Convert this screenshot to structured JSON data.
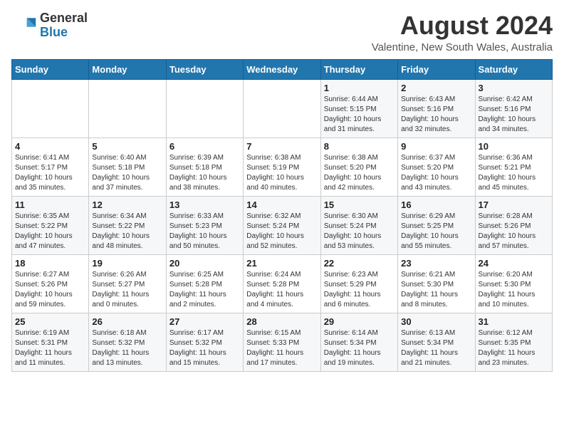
{
  "header": {
    "logo_general": "General",
    "logo_blue": "Blue",
    "month_year": "August 2024",
    "location": "Valentine, New South Wales, Australia"
  },
  "weekdays": [
    "Sunday",
    "Monday",
    "Tuesday",
    "Wednesday",
    "Thursday",
    "Friday",
    "Saturday"
  ],
  "weeks": [
    [
      {
        "day": "",
        "info": ""
      },
      {
        "day": "",
        "info": ""
      },
      {
        "day": "",
        "info": ""
      },
      {
        "day": "",
        "info": ""
      },
      {
        "day": "1",
        "info": "Sunrise: 6:44 AM\nSunset: 5:15 PM\nDaylight: 10 hours\nand 31 minutes."
      },
      {
        "day": "2",
        "info": "Sunrise: 6:43 AM\nSunset: 5:16 PM\nDaylight: 10 hours\nand 32 minutes."
      },
      {
        "day": "3",
        "info": "Sunrise: 6:42 AM\nSunset: 5:16 PM\nDaylight: 10 hours\nand 34 minutes."
      }
    ],
    [
      {
        "day": "4",
        "info": "Sunrise: 6:41 AM\nSunset: 5:17 PM\nDaylight: 10 hours\nand 35 minutes."
      },
      {
        "day": "5",
        "info": "Sunrise: 6:40 AM\nSunset: 5:18 PM\nDaylight: 10 hours\nand 37 minutes."
      },
      {
        "day": "6",
        "info": "Sunrise: 6:39 AM\nSunset: 5:18 PM\nDaylight: 10 hours\nand 38 minutes."
      },
      {
        "day": "7",
        "info": "Sunrise: 6:38 AM\nSunset: 5:19 PM\nDaylight: 10 hours\nand 40 minutes."
      },
      {
        "day": "8",
        "info": "Sunrise: 6:38 AM\nSunset: 5:20 PM\nDaylight: 10 hours\nand 42 minutes."
      },
      {
        "day": "9",
        "info": "Sunrise: 6:37 AM\nSunset: 5:20 PM\nDaylight: 10 hours\nand 43 minutes."
      },
      {
        "day": "10",
        "info": "Sunrise: 6:36 AM\nSunset: 5:21 PM\nDaylight: 10 hours\nand 45 minutes."
      }
    ],
    [
      {
        "day": "11",
        "info": "Sunrise: 6:35 AM\nSunset: 5:22 PM\nDaylight: 10 hours\nand 47 minutes."
      },
      {
        "day": "12",
        "info": "Sunrise: 6:34 AM\nSunset: 5:22 PM\nDaylight: 10 hours\nand 48 minutes."
      },
      {
        "day": "13",
        "info": "Sunrise: 6:33 AM\nSunset: 5:23 PM\nDaylight: 10 hours\nand 50 minutes."
      },
      {
        "day": "14",
        "info": "Sunrise: 6:32 AM\nSunset: 5:24 PM\nDaylight: 10 hours\nand 52 minutes."
      },
      {
        "day": "15",
        "info": "Sunrise: 6:30 AM\nSunset: 5:24 PM\nDaylight: 10 hours\nand 53 minutes."
      },
      {
        "day": "16",
        "info": "Sunrise: 6:29 AM\nSunset: 5:25 PM\nDaylight: 10 hours\nand 55 minutes."
      },
      {
        "day": "17",
        "info": "Sunrise: 6:28 AM\nSunset: 5:26 PM\nDaylight: 10 hours\nand 57 minutes."
      }
    ],
    [
      {
        "day": "18",
        "info": "Sunrise: 6:27 AM\nSunset: 5:26 PM\nDaylight: 10 hours\nand 59 minutes."
      },
      {
        "day": "19",
        "info": "Sunrise: 6:26 AM\nSunset: 5:27 PM\nDaylight: 11 hours\nand 0 minutes."
      },
      {
        "day": "20",
        "info": "Sunrise: 6:25 AM\nSunset: 5:28 PM\nDaylight: 11 hours\nand 2 minutes."
      },
      {
        "day": "21",
        "info": "Sunrise: 6:24 AM\nSunset: 5:28 PM\nDaylight: 11 hours\nand 4 minutes."
      },
      {
        "day": "22",
        "info": "Sunrise: 6:23 AM\nSunset: 5:29 PM\nDaylight: 11 hours\nand 6 minutes."
      },
      {
        "day": "23",
        "info": "Sunrise: 6:21 AM\nSunset: 5:30 PM\nDaylight: 11 hours\nand 8 minutes."
      },
      {
        "day": "24",
        "info": "Sunrise: 6:20 AM\nSunset: 5:30 PM\nDaylight: 11 hours\nand 10 minutes."
      }
    ],
    [
      {
        "day": "25",
        "info": "Sunrise: 6:19 AM\nSunset: 5:31 PM\nDaylight: 11 hours\nand 11 minutes."
      },
      {
        "day": "26",
        "info": "Sunrise: 6:18 AM\nSunset: 5:32 PM\nDaylight: 11 hours\nand 13 minutes."
      },
      {
        "day": "27",
        "info": "Sunrise: 6:17 AM\nSunset: 5:32 PM\nDaylight: 11 hours\nand 15 minutes."
      },
      {
        "day": "28",
        "info": "Sunrise: 6:15 AM\nSunset: 5:33 PM\nDaylight: 11 hours\nand 17 minutes."
      },
      {
        "day": "29",
        "info": "Sunrise: 6:14 AM\nSunset: 5:34 PM\nDaylight: 11 hours\nand 19 minutes."
      },
      {
        "day": "30",
        "info": "Sunrise: 6:13 AM\nSunset: 5:34 PM\nDaylight: 11 hours\nand 21 minutes."
      },
      {
        "day": "31",
        "info": "Sunrise: 6:12 AM\nSunset: 5:35 PM\nDaylight: 11 hours\nand 23 minutes."
      }
    ]
  ]
}
